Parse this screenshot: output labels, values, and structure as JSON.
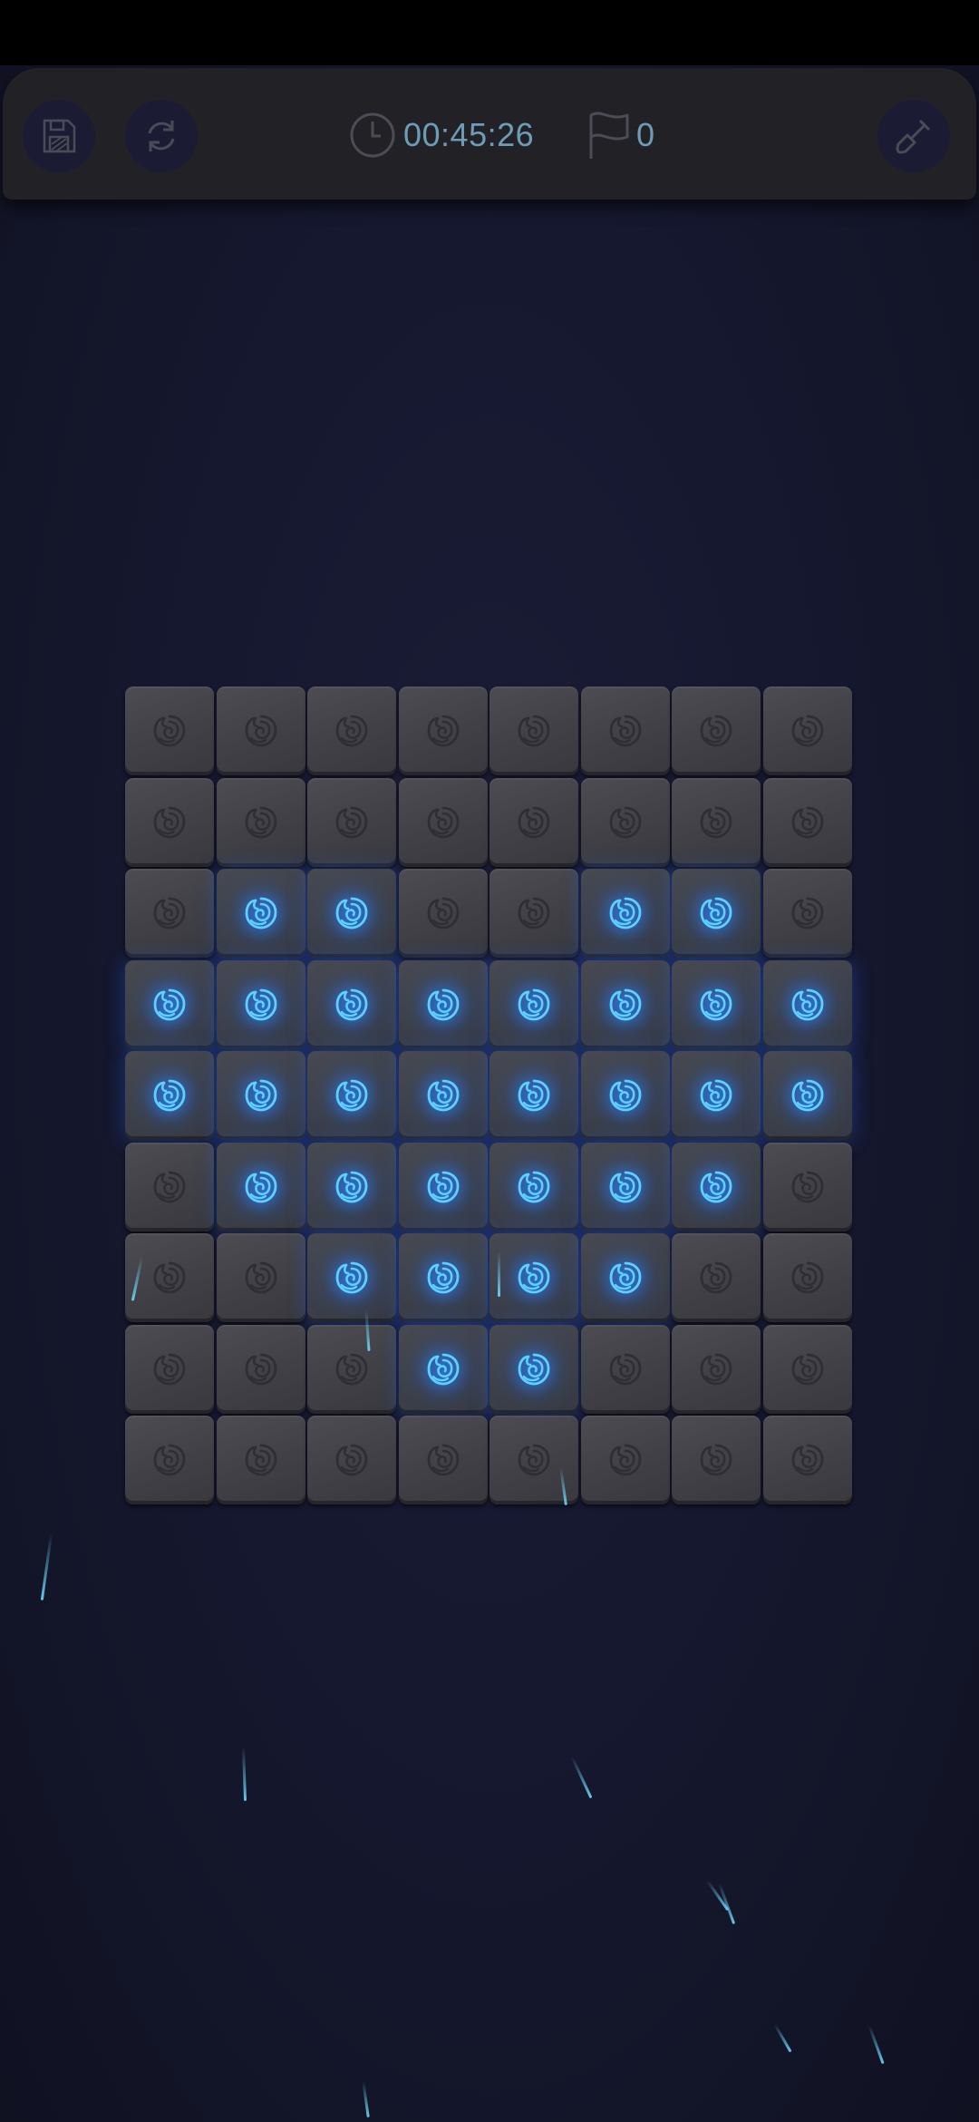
{
  "toolbar": {
    "save_icon": "floppy-disk-icon",
    "restart_icon": "refresh-icon",
    "timer_icon": "clock-icon",
    "timer": "00:45:26",
    "flag_icon": "flag-icon",
    "flag_count": "0",
    "dig_icon": "shovel-icon"
  },
  "board": {
    "rows": 9,
    "cols": 8,
    "tile_icon": "rose-icon",
    "lit": [
      [
        0,
        0,
        0,
        0,
        0,
        0,
        0,
        0
      ],
      [
        0,
        0,
        0,
        0,
        0,
        0,
        0,
        0
      ],
      [
        0,
        1,
        1,
        0,
        0,
        1,
        1,
        0
      ],
      [
        1,
        1,
        1,
        1,
        1,
        1,
        1,
        1
      ],
      [
        1,
        1,
        1,
        1,
        1,
        1,
        1,
        1
      ],
      [
        0,
        1,
        1,
        1,
        1,
        1,
        1,
        0
      ],
      [
        0,
        0,
        1,
        1,
        1,
        1,
        0,
        0
      ],
      [
        0,
        0,
        0,
        1,
        1,
        0,
        0,
        0
      ],
      [
        0,
        0,
        0,
        0,
        0,
        0,
        0,
        0
      ]
    ]
  },
  "colors": {
    "background": "#161830",
    "tile": "#444449",
    "glow": "#2a8cff",
    "text": "#6d9cb8"
  }
}
